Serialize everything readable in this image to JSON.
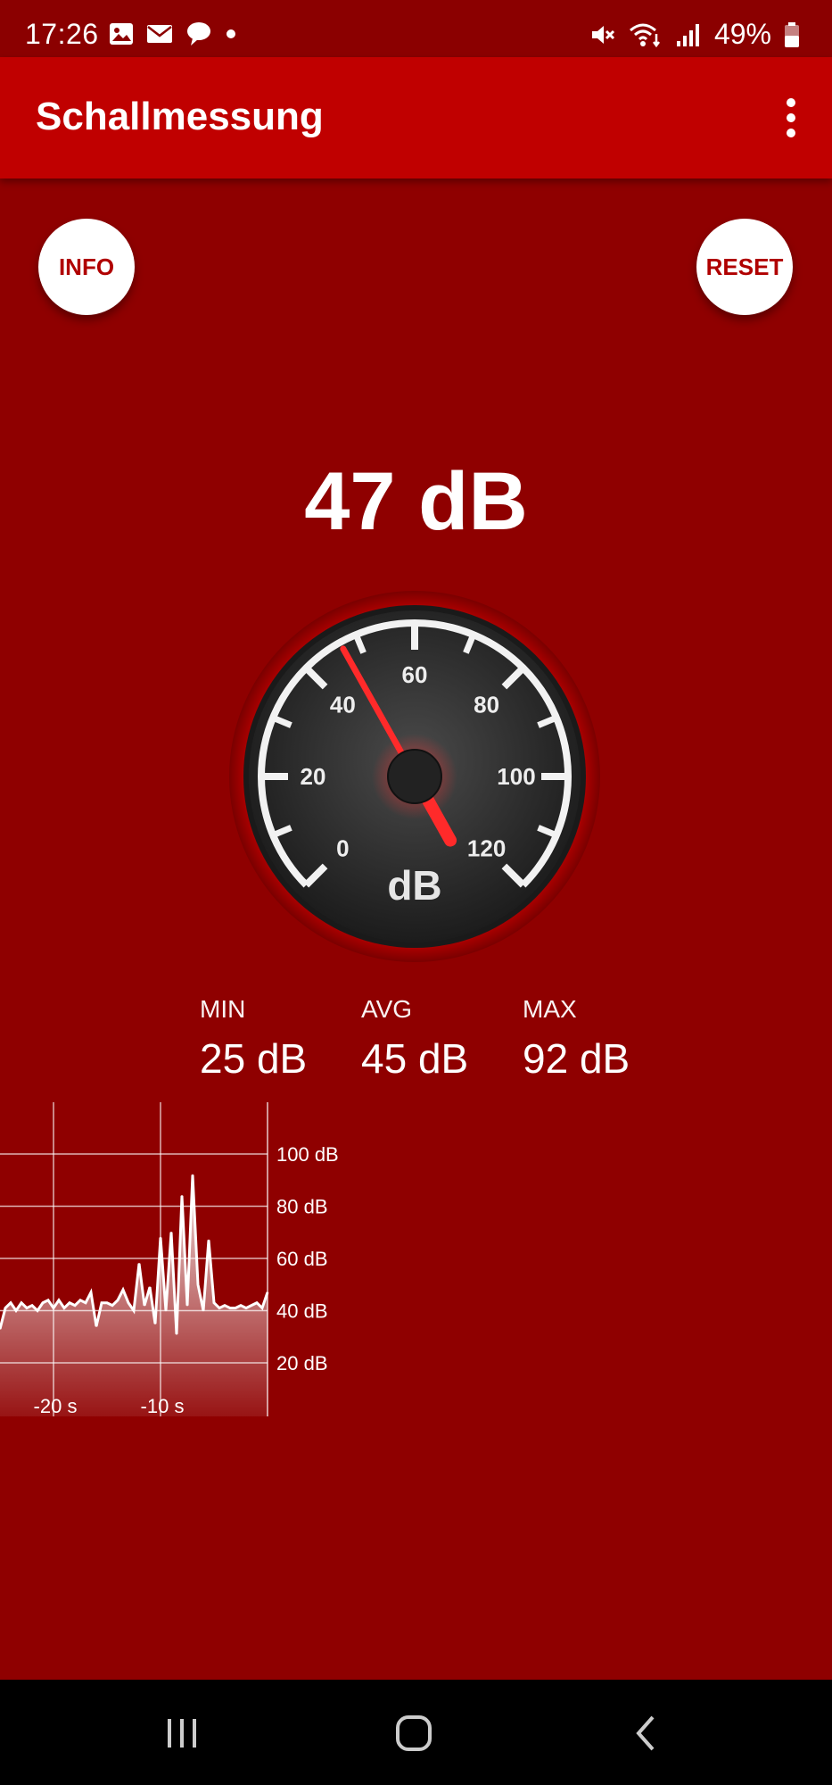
{
  "status_bar": {
    "time": "17:26",
    "battery": "49%"
  },
  "app_bar": {
    "title": "Schallmessung"
  },
  "buttons": {
    "info": "INFO",
    "reset": "RESET"
  },
  "current_level": "47 dB",
  "gauge": {
    "unit": "dB",
    "value": 47,
    "min": 0,
    "max": 120,
    "tick_labels": [
      "0",
      "20",
      "40",
      "60",
      "80",
      "100",
      "120"
    ]
  },
  "stats": {
    "min": {
      "label": "MIN",
      "value": "25 dB"
    },
    "avg": {
      "label": "AVG",
      "value": "45 dB"
    },
    "max": {
      "label": "MAX",
      "value": "92 dB"
    }
  },
  "chart_data": {
    "type": "area",
    "x_tick_labels": [
      "-20 s",
      "-10 s"
    ],
    "y_tick_labels": [
      "100 dB",
      "80 dB",
      "60 dB",
      "40 dB",
      "20 dB"
    ],
    "xlim": [
      -25,
      0
    ],
    "ylim": [
      10,
      110
    ],
    "x": [
      -25,
      -24.5,
      -24,
      -23.5,
      -23,
      -22.5,
      -22,
      -21.5,
      -21,
      -20.5,
      -20,
      -19.5,
      -19,
      -18.5,
      -18,
      -17.5,
      -17,
      -16.5,
      -16,
      -15.5,
      -15,
      -14.5,
      -14,
      -13.5,
      -13,
      -12.5,
      -12,
      -11.5,
      -11,
      -10.5,
      -10,
      -9.5,
      -9,
      -8.5,
      -8,
      -7.5,
      -7,
      -6.5,
      -6,
      -5.5,
      -5,
      -4.5,
      -4,
      -3.5,
      -3,
      -2.5,
      -2,
      -1.5,
      -1,
      -0.5,
      0
    ],
    "values": [
      33,
      41,
      43,
      40,
      43,
      41,
      42,
      40,
      43,
      44,
      41,
      44,
      41,
      43,
      42,
      44,
      43,
      47,
      34,
      43,
      43,
      42,
      44,
      48,
      43,
      40,
      58,
      42,
      49,
      35,
      68,
      40,
      70,
      31,
      84,
      42,
      92,
      50,
      40,
      67,
      43,
      41,
      42,
      41,
      41,
      42,
      41,
      42,
      43,
      41,
      47
    ]
  }
}
